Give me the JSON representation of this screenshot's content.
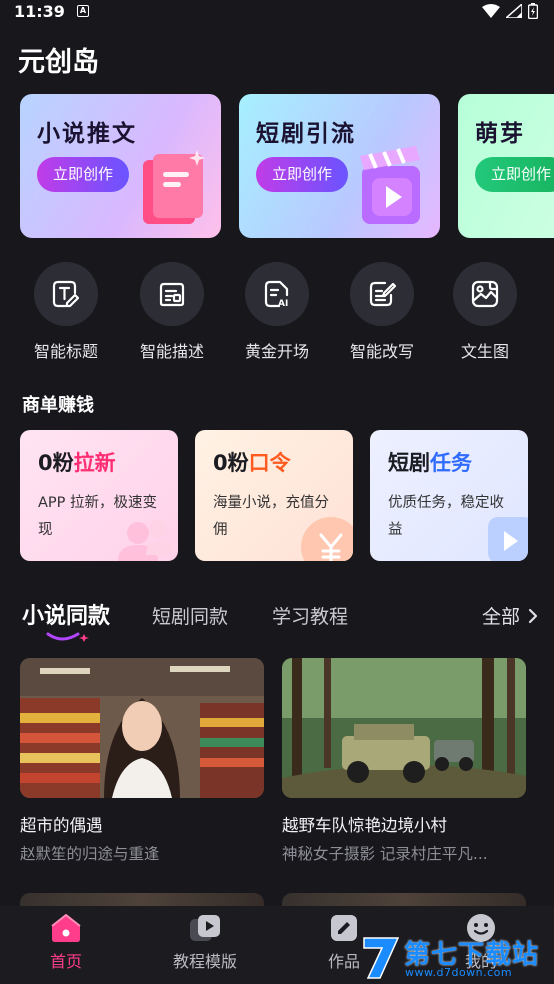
{
  "status_bar": {
    "time": "11:39",
    "notification_icon": "A"
  },
  "app": {
    "title": "元创岛"
  },
  "promo_cards": [
    {
      "title": "小说推文",
      "button": "立即创作"
    },
    {
      "title": "短剧引流",
      "button": "立即创作"
    },
    {
      "title": "萌芽",
      "button": "立即创作"
    }
  ],
  "tools": [
    {
      "label": "智能标题",
      "icon": "title-edit-icon"
    },
    {
      "label": "智能描述",
      "icon": "description-icon"
    },
    {
      "label": "黄金开场",
      "icon": "ai-document-icon"
    },
    {
      "label": "智能改写",
      "icon": "rewrite-icon"
    },
    {
      "label": "文生图",
      "icon": "image-gallery-icon"
    }
  ],
  "business": {
    "title": "商单赚钱",
    "cards": [
      {
        "prefix": "0粉",
        "highlight": "拉新",
        "highlight_color": "#ff2d72",
        "desc": "APP 拉新，极速变现"
      },
      {
        "prefix": "0粉",
        "highlight": "口令",
        "highlight_color": "#ff5a1f",
        "desc": "海量小说，充值分佣"
      },
      {
        "prefix": "短剧",
        "highlight": "任务",
        "highlight_color": "#2f6bff",
        "desc": "优质任务，稳定收益"
      }
    ]
  },
  "tabs": {
    "items": [
      "小说同款",
      "短剧同款",
      "学习教程"
    ],
    "active_index": 0,
    "all_label": "全部"
  },
  "items": [
    {
      "title": "超市的偶遇",
      "subtitle": "赵默笙的归途与重逢"
    },
    {
      "title": "越野车队惊艳边境小村",
      "subtitle": "神秘女子摄影 记录村庄平凡..."
    }
  ],
  "bottom_nav": [
    {
      "label": "首页",
      "icon": "home-icon",
      "active": true
    },
    {
      "label": "教程模版",
      "icon": "tutorial-icon",
      "active": false
    },
    {
      "label": "作品",
      "icon": "works-icon",
      "active": false
    },
    {
      "label": "我的",
      "icon": "profile-icon",
      "active": false
    }
  ],
  "watermark": {
    "text": "第七下载站",
    "url": "www.d7down.com"
  },
  "colors": {
    "accent_pink": "#ff3d8b",
    "background": "#17171c",
    "button_gradient_start": "#c03ce8",
    "button_gradient_end": "#6a54ff"
  }
}
